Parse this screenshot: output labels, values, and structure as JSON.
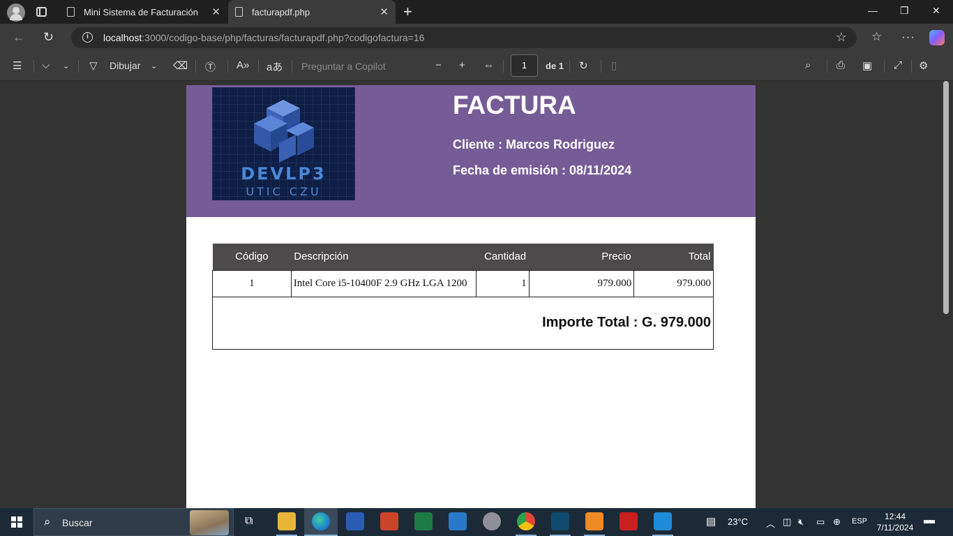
{
  "browser": {
    "tabs": [
      {
        "title": "Mini Sistema de Facturación"
      },
      {
        "title": "facturapdf.php"
      }
    ],
    "url_host": "localhost",
    "url_rest": ":3000/codigo-base/php/facturas/facturapdf.php?codigofactura=16"
  },
  "pdf_toolbar": {
    "draw_label": "Dibujar",
    "copilot_placeholder": "Preguntar a Copilot",
    "page_current": "1",
    "page_total": "de 1"
  },
  "invoice": {
    "logo_line1": "DEVLP3",
    "logo_line2": "UTIC CZU",
    "title": "FACTURA",
    "client_line": "Cliente : Marcos Rodriguez",
    "date_line": "Fecha de emisión : 08/11/2024",
    "table": {
      "headers": [
        "Código",
        "Descripción",
        "Cantidad",
        "Precio",
        "Total"
      ],
      "rows": [
        [
          "1",
          "Intel Core i5-10400F 2.9 GHz LGA 1200",
          "1",
          "979.000",
          "979.000"
        ]
      ],
      "total_label": "Importe Total : G. 979.000"
    }
  },
  "taskbar": {
    "search_label": "Buscar",
    "weather": "23°C",
    "language": "ESP",
    "time": "12:44",
    "date": "7/11/2024"
  },
  "colors": {
    "header_purple": "#765c96",
    "table_header": "#4d4a4b",
    "logo_bg": "#0e1e44"
  }
}
